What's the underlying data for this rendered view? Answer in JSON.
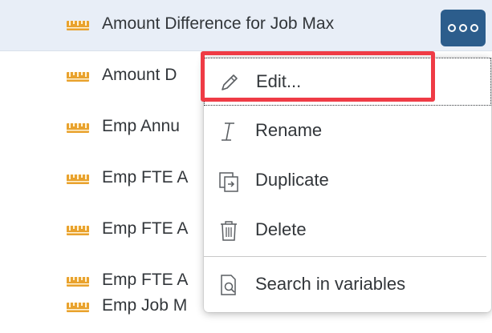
{
  "list": {
    "items": [
      {
        "label": "Amount Difference  for  Job Max",
        "icon": "measure-icon",
        "selected": true
      },
      {
        "label": "Amount D",
        "icon": "measure-icon"
      },
      {
        "label": "Emp Annu",
        "icon": "measure-icon"
      },
      {
        "label": "Emp FTE A",
        "icon": "measure-icon"
      },
      {
        "label": "Emp FTE A",
        "icon": "measure-icon"
      },
      {
        "label": "Emp FTE A",
        "icon": "measure-icon"
      },
      {
        "label": "Emp Job M",
        "icon": "measure-icon"
      }
    ],
    "more_button_icon": "overflow-dots-icon"
  },
  "context_menu": {
    "items": [
      {
        "label": "Edit...",
        "icon": "pencil-icon"
      },
      {
        "label": "Rename",
        "icon": "text-cursor-icon"
      },
      {
        "label": "Duplicate",
        "icon": "duplicate-icon"
      },
      {
        "label": "Delete",
        "icon": "trash-icon"
      },
      {
        "label": "Search in variables",
        "icon": "search-document-icon"
      }
    ]
  },
  "colors": {
    "selected_row_bg": "#e8eef7",
    "accent_button": "#2c5d8c",
    "highlight_box": "#ef3b45",
    "icon_orange": "#e9a22d"
  }
}
